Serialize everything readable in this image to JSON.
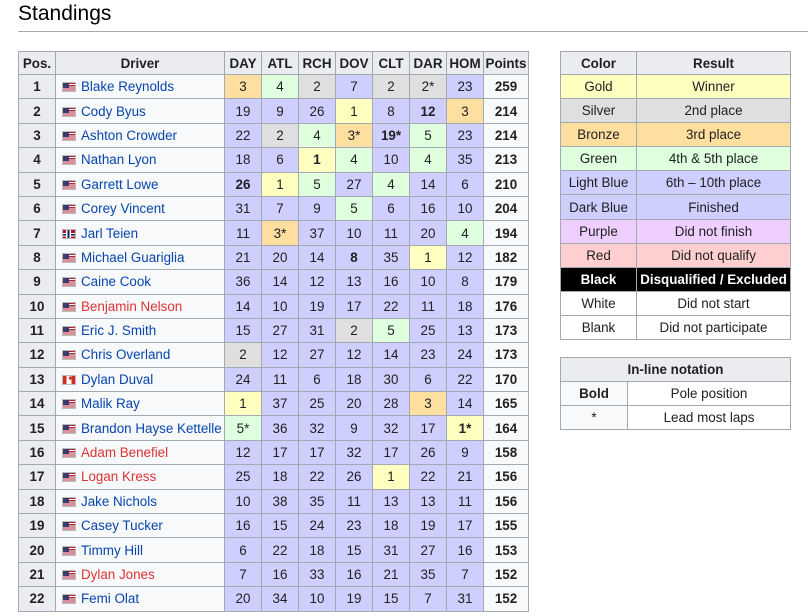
{
  "heading": "Standings",
  "standings": {
    "headers": [
      "Pos.",
      "Driver",
      "DAY",
      "ATL",
      "RCH",
      "DOV",
      "CLT",
      "DAR",
      "HOM",
      "Points"
    ],
    "rows": [
      {
        "pos": "1",
        "driver": "Blake Reynolds",
        "flag": "us",
        "link": "blue",
        "points": "259",
        "results": [
          {
            "v": "3",
            "c": "bronze"
          },
          {
            "v": "4",
            "c": "green"
          },
          {
            "v": "2",
            "c": "silver"
          },
          {
            "v": "7",
            "c": "lblue"
          },
          {
            "v": "2",
            "c": "silver"
          },
          {
            "v": "2*",
            "c": "silver"
          },
          {
            "v": "23",
            "c": "dblue"
          }
        ]
      },
      {
        "pos": "2",
        "driver": "Cody Byus",
        "flag": "us",
        "link": "blue",
        "points": "214",
        "results": [
          {
            "v": "19",
            "c": "dblue"
          },
          {
            "v": "9",
            "c": "lblue"
          },
          {
            "v": "26",
            "c": "dblue"
          },
          {
            "v": "1",
            "c": "gold"
          },
          {
            "v": "8",
            "c": "lblue"
          },
          {
            "v": "12",
            "c": "dblue",
            "b": true
          },
          {
            "v": "3",
            "c": "bronze"
          }
        ]
      },
      {
        "pos": "3",
        "driver": "Ashton Crowder",
        "flag": "us",
        "link": "blue",
        "points": "214",
        "results": [
          {
            "v": "22",
            "c": "dblue"
          },
          {
            "v": "2",
            "c": "silver"
          },
          {
            "v": "4",
            "c": "green"
          },
          {
            "v": "3*",
            "c": "bronze"
          },
          {
            "v": "19*",
            "c": "dblue",
            "b": true
          },
          {
            "v": "5",
            "c": "green"
          },
          {
            "v": "23",
            "c": "dblue"
          }
        ]
      },
      {
        "pos": "4",
        "driver": "Nathan Lyon",
        "flag": "us",
        "link": "blue",
        "points": "213",
        "results": [
          {
            "v": "18",
            "c": "dblue"
          },
          {
            "v": "6",
            "c": "lblue"
          },
          {
            "v": "1",
            "c": "gold",
            "b": true
          },
          {
            "v": "4",
            "c": "green"
          },
          {
            "v": "10",
            "c": "lblue"
          },
          {
            "v": "4",
            "c": "green"
          },
          {
            "v": "35",
            "c": "dblue"
          }
        ]
      },
      {
        "pos": "5",
        "driver": "Garrett Lowe",
        "flag": "us",
        "link": "blue",
        "points": "210",
        "results": [
          {
            "v": "26",
            "c": "dblue",
            "b": true
          },
          {
            "v": "1",
            "c": "gold"
          },
          {
            "v": "5",
            "c": "green"
          },
          {
            "v": "27",
            "c": "dblue"
          },
          {
            "v": "4",
            "c": "green"
          },
          {
            "v": "14",
            "c": "dblue"
          },
          {
            "v": "6",
            "c": "lblue"
          }
        ]
      },
      {
        "pos": "6",
        "driver": "Corey Vincent",
        "flag": "us",
        "link": "blue",
        "points": "204",
        "results": [
          {
            "v": "31",
            "c": "dblue"
          },
          {
            "v": "7",
            "c": "lblue"
          },
          {
            "v": "9",
            "c": "lblue"
          },
          {
            "v": "5",
            "c": "green"
          },
          {
            "v": "6",
            "c": "lblue"
          },
          {
            "v": "16",
            "c": "dblue"
          },
          {
            "v": "10",
            "c": "lblue"
          }
        ]
      },
      {
        "pos": "7",
        "driver": "Jarl Teien",
        "flag": "no",
        "link": "blue",
        "points": "194",
        "results": [
          {
            "v": "11",
            "c": "dblue"
          },
          {
            "v": "3*",
            "c": "bronze"
          },
          {
            "v": "37",
            "c": "dblue"
          },
          {
            "v": "10",
            "c": "lblue"
          },
          {
            "v": "11",
            "c": "dblue"
          },
          {
            "v": "20",
            "c": "dblue"
          },
          {
            "v": "4",
            "c": "green"
          }
        ]
      },
      {
        "pos": "8",
        "driver": "Michael Guariglia",
        "flag": "us",
        "link": "blue",
        "points": "182",
        "results": [
          {
            "v": "21",
            "c": "dblue"
          },
          {
            "v": "20",
            "c": "dblue"
          },
          {
            "v": "14",
            "c": "dblue"
          },
          {
            "v": "8",
            "c": "lblue",
            "b": true
          },
          {
            "v": "35",
            "c": "dblue"
          },
          {
            "v": "1",
            "c": "gold"
          },
          {
            "v": "12",
            "c": "dblue"
          }
        ]
      },
      {
        "pos": "9",
        "driver": "Caine Cook",
        "flag": "us",
        "link": "blue",
        "points": "179",
        "results": [
          {
            "v": "36",
            "c": "dblue"
          },
          {
            "v": "14",
            "c": "dblue"
          },
          {
            "v": "12",
            "c": "dblue"
          },
          {
            "v": "13",
            "c": "dblue"
          },
          {
            "v": "16",
            "c": "dblue"
          },
          {
            "v": "10",
            "c": "lblue"
          },
          {
            "v": "8",
            "c": "lblue"
          }
        ]
      },
      {
        "pos": "10",
        "driver": "Benjamin Nelson",
        "flag": "us",
        "link": "red",
        "points": "176",
        "results": [
          {
            "v": "14",
            "c": "dblue"
          },
          {
            "v": "10",
            "c": "lblue"
          },
          {
            "v": "19",
            "c": "dblue"
          },
          {
            "v": "17",
            "c": "dblue"
          },
          {
            "v": "22",
            "c": "dblue"
          },
          {
            "v": "11",
            "c": "dblue"
          },
          {
            "v": "18",
            "c": "dblue"
          }
        ]
      },
      {
        "pos": "11",
        "driver": "Eric J. Smith",
        "flag": "us",
        "link": "blue",
        "points": "173",
        "results": [
          {
            "v": "15",
            "c": "dblue"
          },
          {
            "v": "27",
            "c": "dblue"
          },
          {
            "v": "31",
            "c": "dblue"
          },
          {
            "v": "2",
            "c": "silver"
          },
          {
            "v": "5",
            "c": "green"
          },
          {
            "v": "25",
            "c": "dblue"
          },
          {
            "v": "13",
            "c": "dblue"
          }
        ]
      },
      {
        "pos": "12",
        "driver": "Chris Overland",
        "flag": "us",
        "link": "blue",
        "points": "173",
        "results": [
          {
            "v": "2",
            "c": "silver"
          },
          {
            "v": "12",
            "c": "dblue"
          },
          {
            "v": "27",
            "c": "dblue"
          },
          {
            "v": "12",
            "c": "dblue"
          },
          {
            "v": "14",
            "c": "dblue"
          },
          {
            "v": "23",
            "c": "dblue"
          },
          {
            "v": "24",
            "c": "dblue"
          }
        ]
      },
      {
        "pos": "13",
        "driver": "Dylan Duval",
        "flag": "ca",
        "link": "blue",
        "points": "170",
        "results": [
          {
            "v": "24",
            "c": "dblue"
          },
          {
            "v": "11",
            "c": "dblue"
          },
          {
            "v": "6",
            "c": "lblue"
          },
          {
            "v": "18",
            "c": "dblue"
          },
          {
            "v": "30",
            "c": "dblue"
          },
          {
            "v": "6",
            "c": "lblue"
          },
          {
            "v": "22",
            "c": "dblue"
          }
        ]
      },
      {
        "pos": "14",
        "driver": "Malik Ray",
        "flag": "us",
        "link": "blue",
        "points": "165",
        "results": [
          {
            "v": "1",
            "c": "gold"
          },
          {
            "v": "37",
            "c": "dblue"
          },
          {
            "v": "25",
            "c": "dblue"
          },
          {
            "v": "20",
            "c": "dblue"
          },
          {
            "v": "28",
            "c": "dblue"
          },
          {
            "v": "3",
            "c": "bronze"
          },
          {
            "v": "14",
            "c": "dblue"
          }
        ]
      },
      {
        "pos": "15",
        "driver": "Brandon Hayse Kettelle",
        "flag": "us",
        "link": "blue",
        "points": "164",
        "results": [
          {
            "v": "5*",
            "c": "green"
          },
          {
            "v": "36",
            "c": "dblue"
          },
          {
            "v": "32",
            "c": "dblue"
          },
          {
            "v": "9",
            "c": "lblue"
          },
          {
            "v": "32",
            "c": "dblue"
          },
          {
            "v": "17",
            "c": "dblue"
          },
          {
            "v": "1*",
            "c": "gold",
            "b": true
          }
        ]
      },
      {
        "pos": "16",
        "driver": "Adam Benefiel",
        "flag": "us",
        "link": "red",
        "points": "158",
        "results": [
          {
            "v": "12",
            "c": "dblue"
          },
          {
            "v": "17",
            "c": "dblue"
          },
          {
            "v": "17",
            "c": "dblue"
          },
          {
            "v": "32",
            "c": "dblue"
          },
          {
            "v": "17",
            "c": "dblue"
          },
          {
            "v": "26",
            "c": "dblue"
          },
          {
            "v": "9",
            "c": "lblue"
          }
        ]
      },
      {
        "pos": "17",
        "driver": "Logan Kress",
        "flag": "us",
        "link": "red",
        "points": "156",
        "results": [
          {
            "v": "25",
            "c": "dblue"
          },
          {
            "v": "18",
            "c": "dblue"
          },
          {
            "v": "22",
            "c": "dblue"
          },
          {
            "v": "26",
            "c": "dblue"
          },
          {
            "v": "1",
            "c": "gold"
          },
          {
            "v": "22",
            "c": "dblue"
          },
          {
            "v": "21",
            "c": "dblue"
          }
        ]
      },
      {
        "pos": "18",
        "driver": "Jake Nichols",
        "flag": "us",
        "link": "blue",
        "points": "156",
        "results": [
          {
            "v": "10",
            "c": "lblue"
          },
          {
            "v": "38",
            "c": "dblue"
          },
          {
            "v": "35",
            "c": "dblue"
          },
          {
            "v": "11",
            "c": "dblue"
          },
          {
            "v": "13",
            "c": "dblue"
          },
          {
            "v": "13",
            "c": "dblue"
          },
          {
            "v": "11",
            "c": "dblue"
          }
        ]
      },
      {
        "pos": "19",
        "driver": "Casey Tucker",
        "flag": "us",
        "link": "blue",
        "points": "155",
        "results": [
          {
            "v": "16",
            "c": "dblue"
          },
          {
            "v": "15",
            "c": "dblue"
          },
          {
            "v": "24",
            "c": "dblue"
          },
          {
            "v": "23",
            "c": "dblue"
          },
          {
            "v": "18",
            "c": "dblue"
          },
          {
            "v": "19",
            "c": "dblue"
          },
          {
            "v": "17",
            "c": "dblue"
          }
        ]
      },
      {
        "pos": "20",
        "driver": "Timmy Hill",
        "flag": "us",
        "link": "blue",
        "points": "153",
        "results": [
          {
            "v": "6",
            "c": "lblue"
          },
          {
            "v": "22",
            "c": "dblue"
          },
          {
            "v": "18",
            "c": "dblue"
          },
          {
            "v": "15",
            "c": "dblue"
          },
          {
            "v": "31",
            "c": "dblue"
          },
          {
            "v": "27",
            "c": "dblue"
          },
          {
            "v": "16",
            "c": "dblue"
          }
        ]
      },
      {
        "pos": "21",
        "driver": "Dylan Jones",
        "flag": "us",
        "link": "red",
        "points": "152",
        "results": [
          {
            "v": "7",
            "c": "lblue"
          },
          {
            "v": "16",
            "c": "dblue"
          },
          {
            "v": "33",
            "c": "dblue"
          },
          {
            "v": "16",
            "c": "dblue"
          },
          {
            "v": "21",
            "c": "dblue"
          },
          {
            "v": "35",
            "c": "dblue"
          },
          {
            "v": "7",
            "c": "lblue"
          }
        ]
      },
      {
        "pos": "22",
        "driver": "Femi Olat",
        "flag": "us",
        "link": "blue",
        "points": "152",
        "results": [
          {
            "v": "20",
            "c": "dblue"
          },
          {
            "v": "34",
            "c": "dblue"
          },
          {
            "v": "10",
            "c": "lblue"
          },
          {
            "v": "19",
            "c": "dblue"
          },
          {
            "v": "15",
            "c": "dblue"
          },
          {
            "v": "7",
            "c": "lblue"
          },
          {
            "v": "31",
            "c": "dblue"
          }
        ]
      }
    ]
  },
  "legend": {
    "headers": [
      "Color",
      "Result"
    ],
    "rows": [
      {
        "color": "Gold",
        "result": "Winner",
        "c": "gold"
      },
      {
        "color": "Silver",
        "result": "2nd place",
        "c": "silver"
      },
      {
        "color": "Bronze",
        "result": "3rd place",
        "c": "bronze"
      },
      {
        "color": "Green",
        "result": "4th & 5th place",
        "c": "green"
      },
      {
        "color": "Light Blue",
        "result": "6th – 10th place",
        "c": "lblue"
      },
      {
        "color": "Dark Blue",
        "result": "Finished",
        "c": "dblue"
      },
      {
        "color": "Purple",
        "result": "Did not finish",
        "c": "purple"
      },
      {
        "color": "Red",
        "result": "Did not qualify",
        "c": "red"
      },
      {
        "color": "Black",
        "result": "Disqualified / Excluded",
        "c": "black"
      },
      {
        "color": "White",
        "result": "Did not start",
        "c": "white"
      },
      {
        "color": "Blank",
        "result": "Did not participate",
        "c": "blank"
      }
    ]
  },
  "notation": {
    "title": "In-line notation",
    "rows": [
      {
        "key": "Bold",
        "desc": "Pole position",
        "bold": true
      },
      {
        "key": "*",
        "desc": "Lead most laps",
        "bold": false
      }
    ]
  },
  "colors": {
    "gold": "#ffffbf",
    "silver": "#dfdfdf",
    "bronze": "#ffdf9f",
    "green": "#dfffdf",
    "light_blue": "#cfcfff",
    "dark_blue": "#cfcfff",
    "purple": "#efcfff",
    "red": "#ffcfcf",
    "black": "#000000",
    "white": "#ffffff",
    "link": "#0645ad",
    "link_red": "#d33333"
  }
}
